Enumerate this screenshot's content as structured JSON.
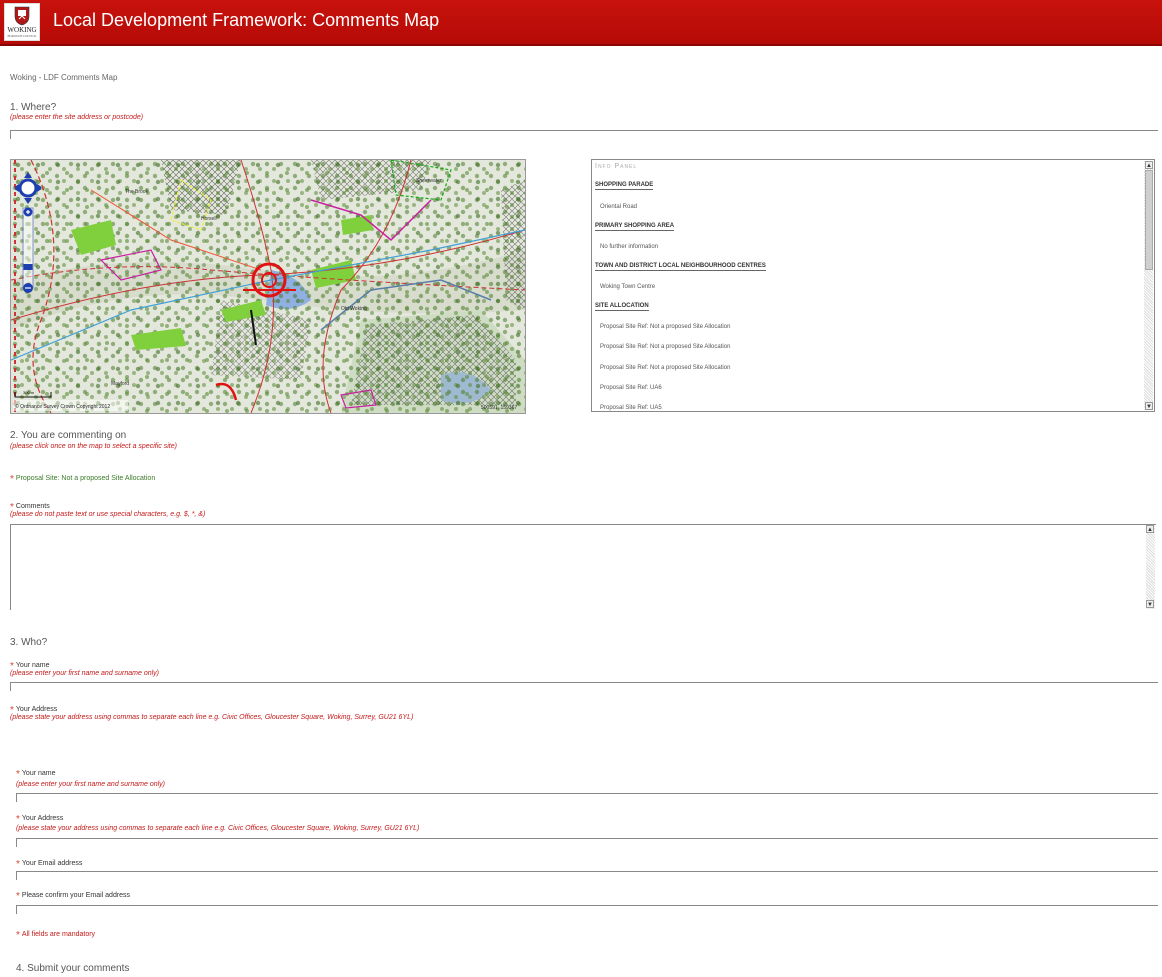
{
  "header": {
    "title": "Local Development Framework: Comments Map",
    "logo_text": "WOKING",
    "logo_subtext": "BOROUGH COUNCIL",
    "bg_color": "#c4100a"
  },
  "page_title": "Woking - LDF Comments Map",
  "where": {
    "heading": "1. Where?",
    "hint": "(please enter the site address or postcode)",
    "value": ""
  },
  "map": {
    "scale_label": "300 m",
    "copyright": "© Ordnance Survey Crown Copyright 2012",
    "coords": "500591, 159367",
    "place_labels": [
      "The Brook",
      "Sheerwater",
      "Horsell",
      "Old Woking",
      "Mayford"
    ]
  },
  "info_panel": {
    "title": "Info Panel",
    "sections": [
      {
        "heading": "Shopping Parade",
        "items": [
          "Oriental Road"
        ]
      },
      {
        "heading": "Primary Shopping Area",
        "items": [
          "No further information"
        ]
      },
      {
        "heading": "Town and District Local Neighbourhood Centres",
        "items": [
          "Woking Town Centre"
        ]
      },
      {
        "heading": "Site Allocation",
        "items": [
          "Proposal Site Ref:   Not a proposed Site Allocation",
          "Proposal Site Ref:   Not a proposed Site Allocation",
          "Proposal Site Ref:   Not a proposed Site Allocation",
          "Proposal Site Ref:   UA6",
          "Proposal Site Ref:   UA5"
        ]
      }
    ]
  },
  "commenting": {
    "heading": "2. You are commenting on",
    "hint": "(please click once on the map to select a specific site)",
    "selected": "Proposal Site: Not a proposed Site Allocation"
  },
  "comments": {
    "label": "Comments",
    "hint": "(please do not paste text or use special characters, e.g. $, *, &)",
    "value": ""
  },
  "who": {
    "heading": "3. Who?",
    "name_label": "Your name",
    "name_hint": "(please enter your first name and surname only)",
    "address_label": "Your Address",
    "address_hint": "(please state your address using commas to separate each line e.g. Civic Offices, Gloucester Square, Woking, Surrey, GU21 6YL)",
    "email_label": "Your Email address",
    "confirm_email_label": "Please confirm your Email address",
    "mandatory_note": "All fields are mandatory"
  },
  "submit": {
    "heading": "4. Submit your comments"
  },
  "required_mark": "*",
  "colors": {
    "accent_red": "#c41818",
    "selected_green": "#3a7a2a"
  }
}
